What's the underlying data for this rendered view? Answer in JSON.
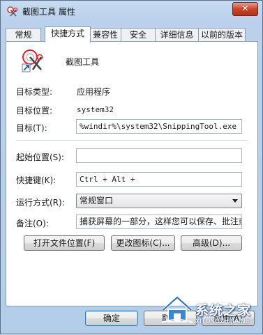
{
  "window": {
    "title": "截图工具 属性",
    "close_label": "✕"
  },
  "tabs": [
    {
      "label": "常规"
    },
    {
      "label": "快捷方式"
    },
    {
      "label": "兼容性"
    },
    {
      "label": "安全"
    },
    {
      "label": "详细信息"
    },
    {
      "label": "以前的版本"
    }
  ],
  "header": {
    "name": "截图工具"
  },
  "info": {
    "type_label": "目标类型:",
    "type_value": "应用程序",
    "location_label": "目标位置:",
    "location_value": "system32",
    "target_label": "目标(T):",
    "target_value": "%windir%\\system32\\SnippingTool.exe"
  },
  "form": {
    "start_in_label": "起始位置(S):",
    "start_in_value": "",
    "hotkey_label": "快捷键(K):",
    "hotkey_value": "Ctrl + Alt +",
    "run_label": "运行方式(R):",
    "run_value": "常规窗口",
    "comment_label": "备注(O):",
    "comment_value": "捕获屏幕的一部分，这样您可以保存、批注或"
  },
  "actions": {
    "open_location": "打开文件位置(F)",
    "change_icon": "更改图标(C)...",
    "advanced": "高级(D)..."
  },
  "footer": {
    "ok": "确定",
    "cancel": "取消",
    "apply": "应用(A)"
  },
  "watermark": {
    "brand": "系统之家",
    "url": "XITONGZHIJIA.NET"
  },
  "colors": {
    "accent": "#3c7fb1",
    "close": "#c8452f"
  }
}
